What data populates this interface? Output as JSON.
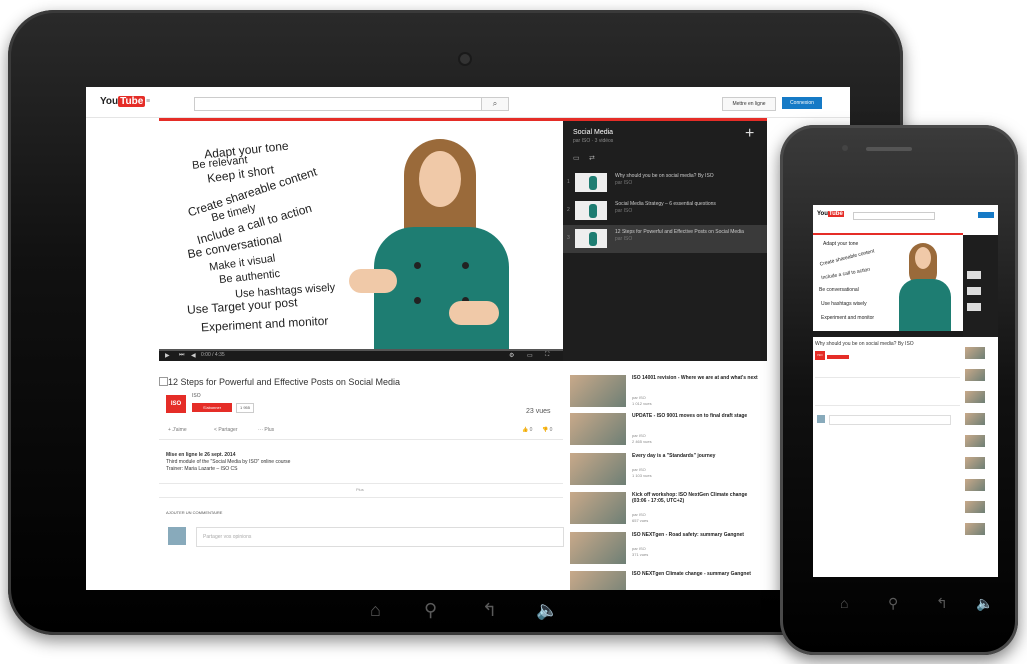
{
  "header": {
    "logo_you": "You",
    "logo_tube": "Tube",
    "login_label": "Mettre en ligne",
    "connect_label": "Connexion"
  },
  "video": {
    "overlay_lines": [
      "Adapt your tone",
      "Be relevant",
      "Keep it short",
      "Create shareable content",
      "Be timely",
      "Include a call to action",
      "Be conversational",
      "Make it visual",
      "Be authentic",
      "Use hashtags wisely",
      "Use Target your post",
      "Experiment and monitor"
    ],
    "time": "0:00 / 4:35"
  },
  "playlist": {
    "title": "Social Media",
    "subtitle": "par ISO · 3 vidéos",
    "items": [
      {
        "num": "1",
        "title": "Why should you be on social media? By ISO",
        "by": "par ISO"
      },
      {
        "num": "2",
        "title": "Social Media Strategy – 6 essential questions",
        "by": "par ISO"
      },
      {
        "num": "3",
        "title": "12 Steps for Powerful and Effective Posts on Social Media",
        "by": "par ISO"
      }
    ]
  },
  "main": {
    "title": "12 Steps for Powerful and Effective Posts on Social Media",
    "channel": "ISO",
    "channel_logo": "ISO",
    "subscribe_label": "S'abonner",
    "sub_count": "1 955",
    "views": "23 vues",
    "actions": [
      "J'aime",
      "Partager",
      "Plus"
    ],
    "likes": "0",
    "dislikes": "0",
    "desc_line1": "Mise en ligne le 26 sept. 2014",
    "desc_line2": "Third module of the \"Social Media by ISO\" online course",
    "desc_line3": "Trainer: Maria Lazarte – ISO CS",
    "more_label": "Plus",
    "comments_heading": "AJOUTER UN COMMENTAIRE",
    "comment_placeholder": "Partager vos opinions"
  },
  "related": [
    {
      "title": "ISO 14001 revision - Where we are at and what's next",
      "by": "par ISO",
      "views": "1 012 vues"
    },
    {
      "title": "UPDATE - ISO 9001 moves on to final draft stage",
      "by": "par ISO",
      "views": "2 465 vues"
    },
    {
      "title": "Every day is a \"Standards\" journey",
      "by": "par ISO",
      "views": "1 103 vues"
    },
    {
      "title": "Kick off workshop: ISO NextGen Climate change (03:06 - 17:05, UTC+2)",
      "by": "par ISO",
      "views": "657 vues"
    },
    {
      "title": "ISO NEXTgen - Road safety: summary Gangnet",
      "by": "par ISO",
      "views": "371 vues"
    },
    {
      "title": "ISO NEXTgen Climate change - summary Gangnet",
      "by": "par ISO",
      "views": "403 vues"
    }
  ],
  "phone": {
    "title": "Why should you be on social media? By ISO",
    "related_count": "9"
  },
  "colors": {
    "accent_red": "#e52d27",
    "accent_blue": "#167ac6",
    "teal": "#1e7d72"
  }
}
